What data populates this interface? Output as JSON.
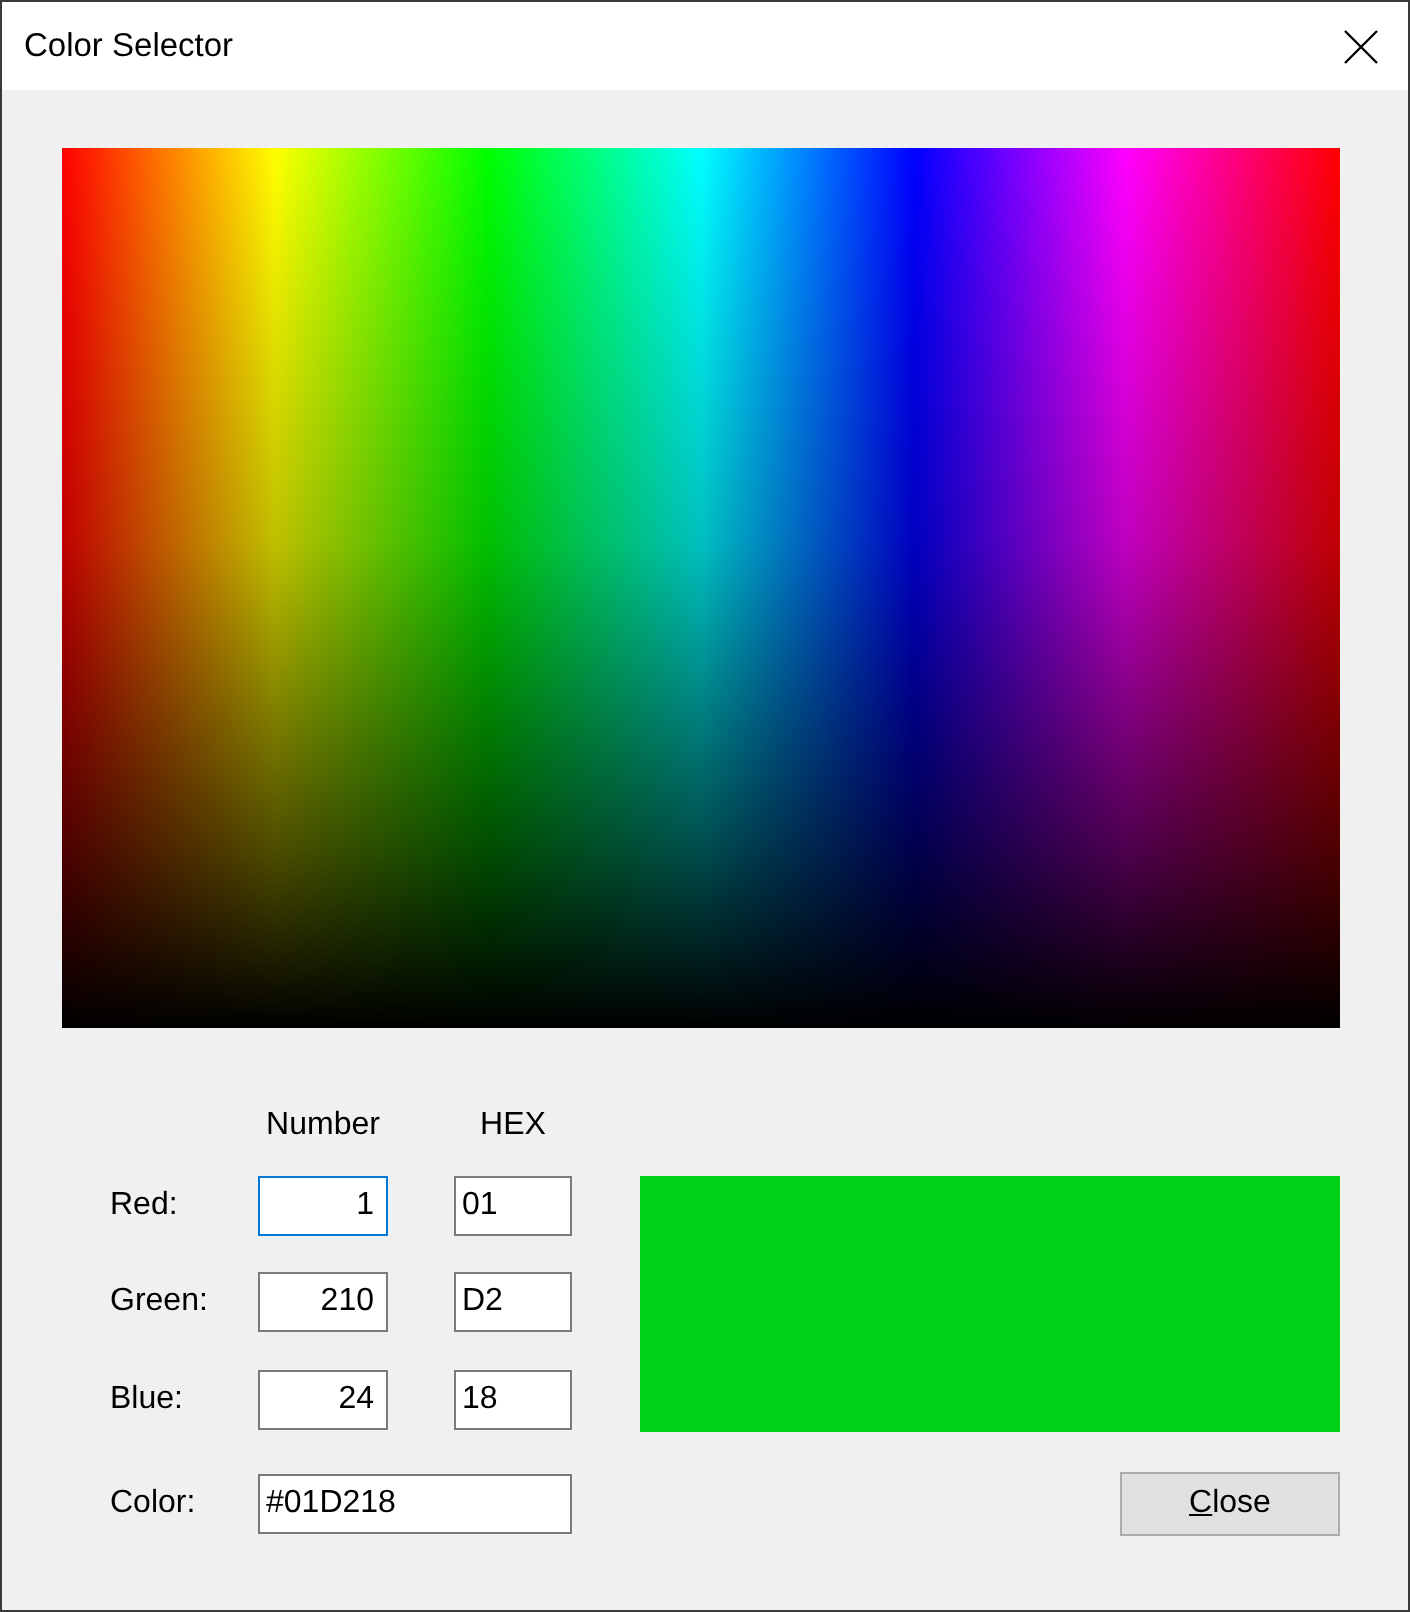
{
  "window": {
    "title": "Color Selector"
  },
  "columns": [
    "Number",
    "HEX"
  ],
  "channels": [
    {
      "label": "Red:",
      "number": "1",
      "hex": "01",
      "focused": true
    },
    {
      "label": "Green:",
      "number": "210",
      "hex": "D2",
      "focused": false
    },
    {
      "label": "Blue:",
      "number": "24",
      "hex": "18",
      "focused": false
    }
  ],
  "color": {
    "label": "Color:",
    "value": "#01D218"
  },
  "buttons": [
    {
      "label": "Close"
    }
  ]
}
